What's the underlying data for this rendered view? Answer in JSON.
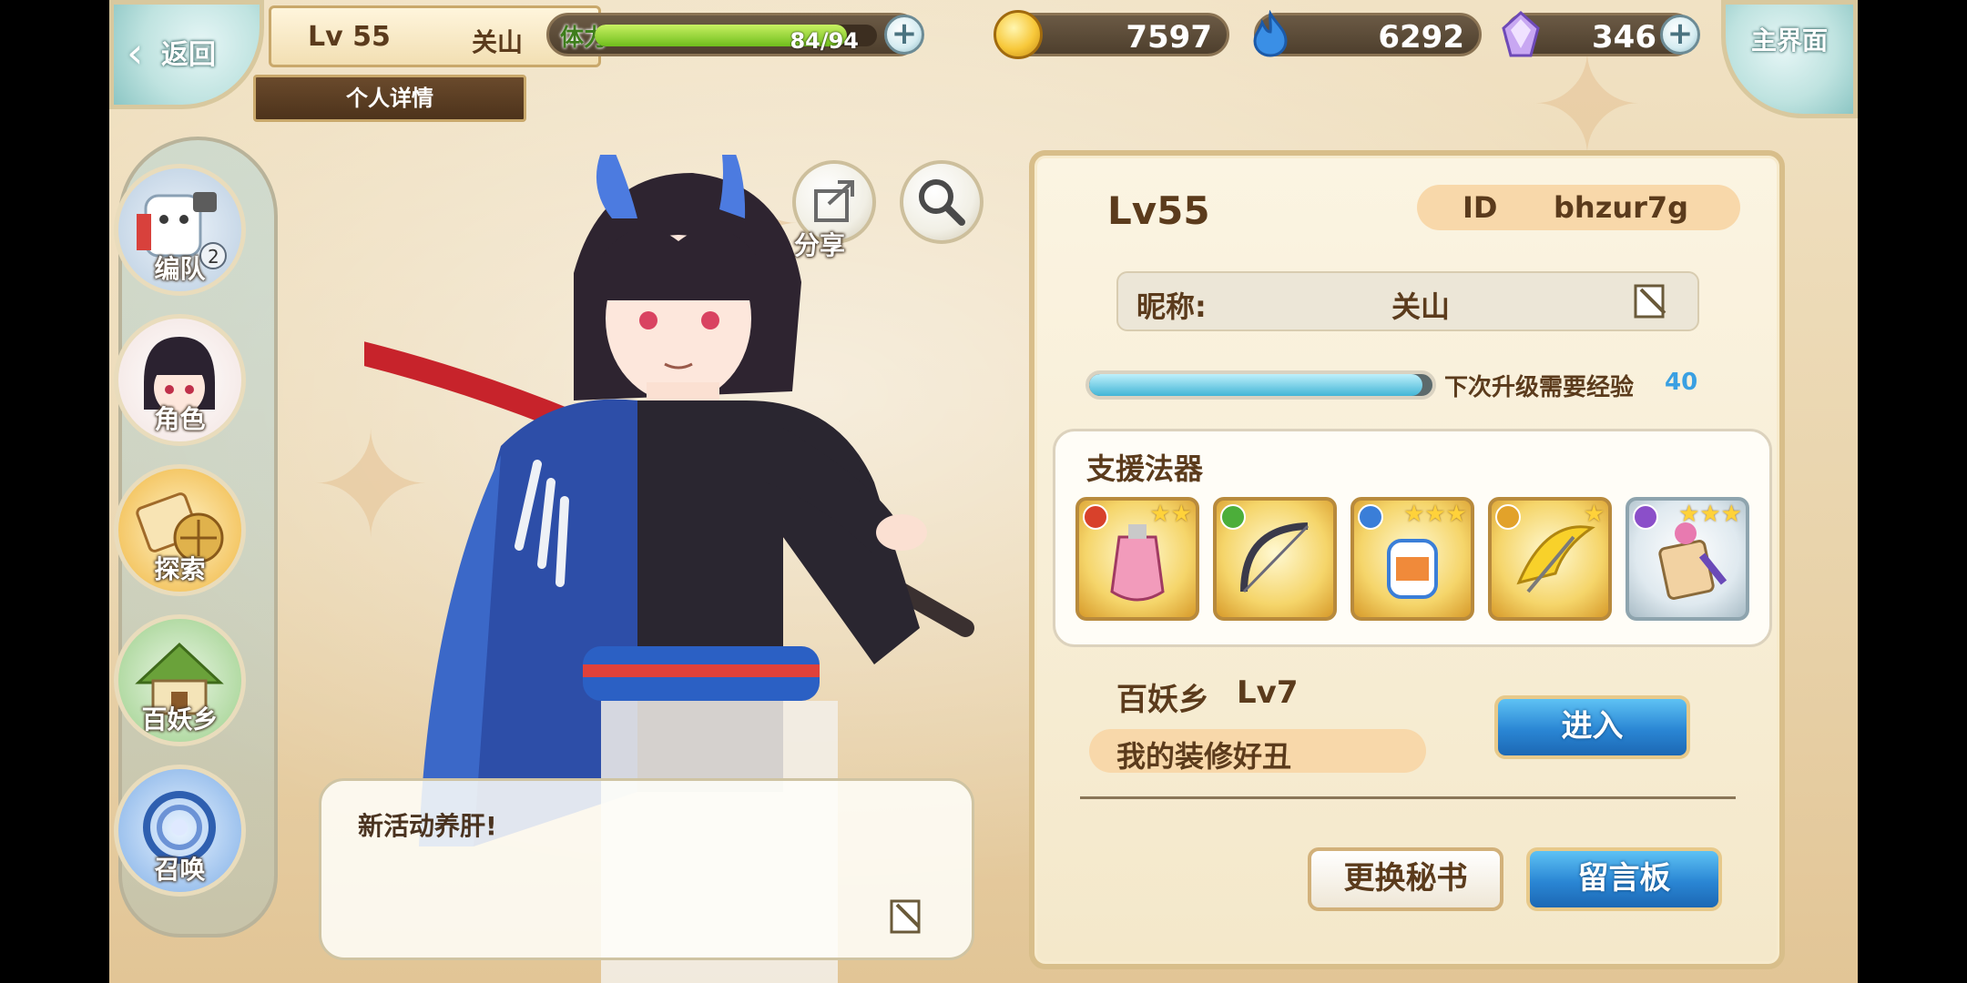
{
  "top": {
    "back_label": "返回",
    "level": "Lv 55",
    "name": "关山",
    "detail_tab": "个人详情",
    "stamina_label": "体力",
    "stamina_text": "84/94",
    "stamina_fraction": 0.894,
    "gold": "7597",
    "blue_currency": "6292",
    "crystal": "346",
    "main_menu_label": "主界面"
  },
  "nav": {
    "items": [
      {
        "label": "编队",
        "icon": "team-icon"
      },
      {
        "label": "角色",
        "icon": "character-icon"
      },
      {
        "label": "探索",
        "icon": "explore-icon"
      },
      {
        "label": "百妖乡",
        "icon": "village-icon"
      },
      {
        "label": "召唤",
        "icon": "summon-icon"
      }
    ]
  },
  "character": {
    "share_label": "分享",
    "bubble_text": "新活动养肝!"
  },
  "profile": {
    "level": "Lv55",
    "id_key": "ID",
    "id_value": "bhzur7g",
    "nick_key": "昵称:",
    "nick_value": "关山",
    "exp_label": "下次升级需要经验",
    "exp_value": "40",
    "exp_fraction": 0.97,
    "support_title": "支援法器",
    "slots": [
      {
        "icon": "perfume-bottle-icon",
        "stars": "★★",
        "gem_color": "#d8412b"
      },
      {
        "icon": "dark-bow-icon",
        "stars": "",
        "gem_color": "#4cae3a"
      },
      {
        "icon": "jar-charm-icon",
        "stars": "★★★",
        "gem_color": "#3a7ed8"
      },
      {
        "icon": "golden-bird-icon",
        "stars": "★",
        "gem_color": "#e2a22a"
      },
      {
        "icon": "talisman-tag-icon",
        "stars": "★★★",
        "gem_color": "#8b4fc9"
      }
    ],
    "village_label": "百妖乡",
    "village_level": "Lv7",
    "village_note": "我的装修好丑",
    "enter_label": "进入",
    "change_secretary_label": "更换秘书",
    "message_board_label": "留言板"
  }
}
